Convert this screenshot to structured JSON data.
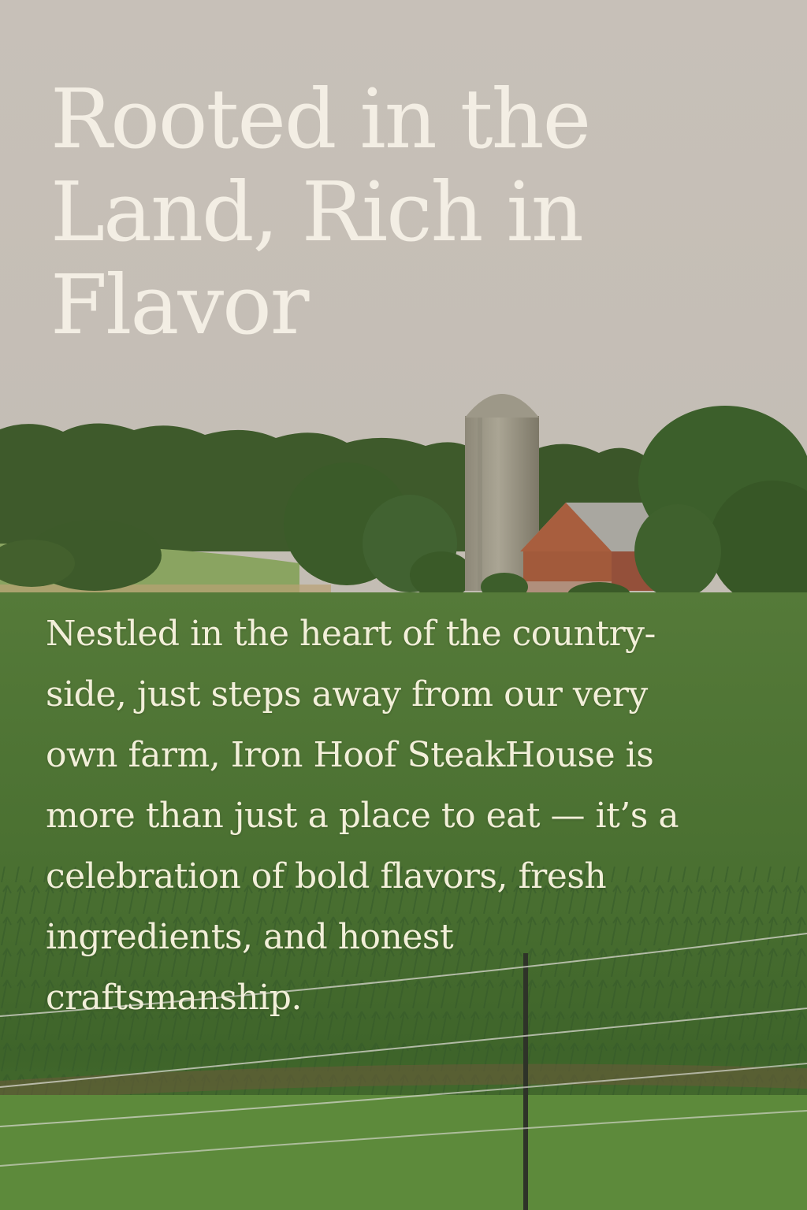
{
  "hero": {
    "headline_lines": [
      "Rooted in the",
      "Land, Rich in",
      "Flavor"
    ],
    "body_lines": [
      "Nestled in the heart of the country-",
      "side, just steps away from our very",
      "own farm, Iron Hoof SteakHouse is",
      "more than just a place to eat — it’s a",
      "celebration of bold flavors, fresh",
      "ingredients, and honest",
      "craftsmanship."
    ]
  },
  "colors": {
    "sky": "#c8c1ba",
    "headline_text": "#f3eee4",
    "body_text": "#f2efd9",
    "treeline": "#3f5a2c",
    "field": "#4f7535",
    "barn": "#a75f3f",
    "silo": "#a39d8d"
  }
}
